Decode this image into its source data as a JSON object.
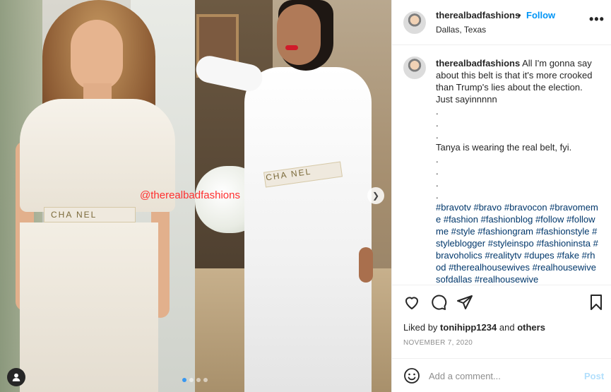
{
  "post": {
    "username": "therealbadfashions",
    "separator": "•",
    "follow_label": "Follow",
    "location": "Dallas, Texas",
    "more_label": "•••",
    "caption_username": "therealbadfashions",
    "caption_lines": [
      "All I'm gonna say about this belt is that it's more crooked than Trump's lies about the election. Just sayinnnnn",
      ".",
      ".",
      ".",
      "Tanya is wearing the real belt, fyi.",
      ".",
      ".",
      ".",
      "."
    ],
    "hashtags": "#bravotv #bravo #bravocon #bravomeme #fashion #fashionblog #follow #followme #style #fashiongram #fashionstyle #styleblogger #styleinspo #fashioninsta #bravoholics #realitytv #dupes  #fake #rhod #therealhousewives #realhousewivesofdallas #realhousewive",
    "liked_by_prefix": "Liked by",
    "liked_by_user": "tonihipp1234",
    "liked_by_and": "and",
    "liked_by_others": "others",
    "date": "NOVEMBER 7, 2020"
  },
  "media": {
    "watermark": "@therealbadfashions",
    "belt_text_left": "CHA  NEL",
    "belt_text_right": "CHA  NEL",
    "carousel_total": 4,
    "carousel_active": 1
  },
  "comment": {
    "placeholder": "Add a comment...",
    "post_label": "Post"
  },
  "icons": {
    "like": "heart-icon",
    "comment": "comment-icon",
    "share": "paper-plane-icon",
    "save": "bookmark-icon",
    "emoji": "smiley-icon",
    "tag": "user-tag-icon",
    "next": "chevron-right-icon"
  },
  "colors": {
    "link_blue": "#0095f6",
    "hashtag_blue": "#00376b",
    "post_disabled": "#b2dffc",
    "watermark_red": "#ff2f2f"
  }
}
